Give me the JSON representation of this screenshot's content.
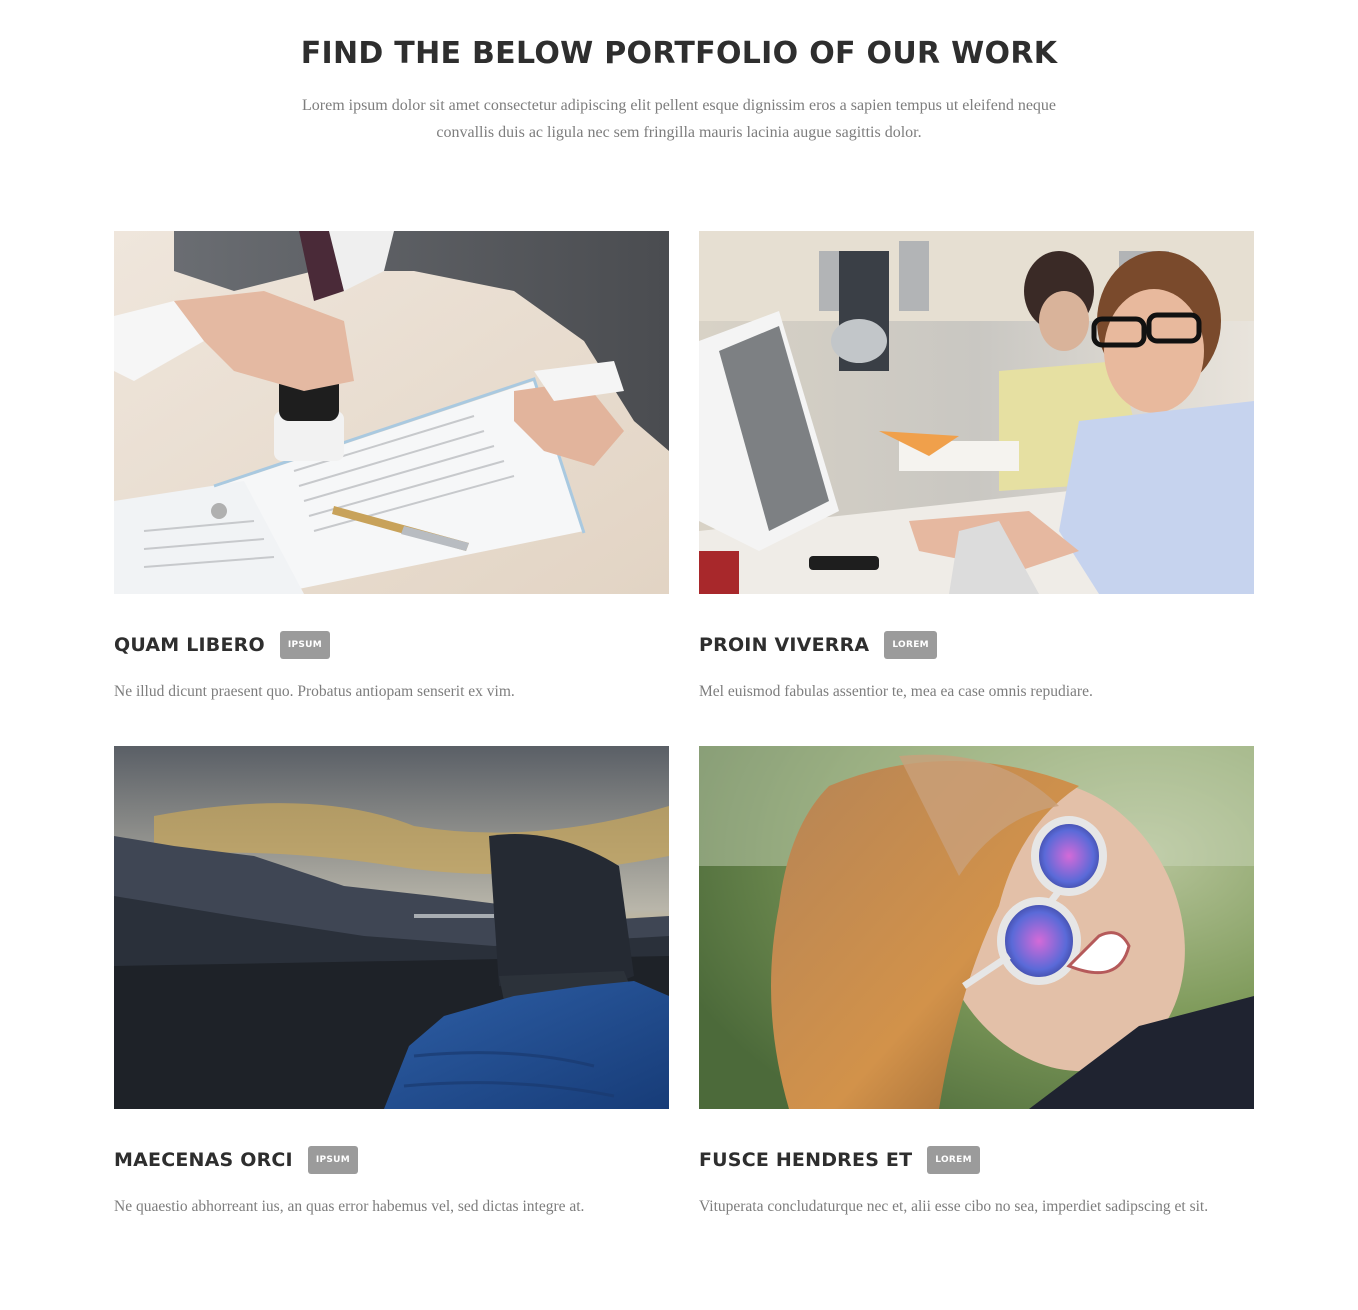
{
  "section": {
    "title": "FIND THE BELOW PORTFOLIO OF OUR WORK",
    "intro": "Lorem ipsum dolor sit amet consectetur adipiscing elit pellent esque dignissim eros a sapien tempus ut eleifend neque convallis duis ac ligula nec sem fringilla mauris lacinia augue sagittis dolor."
  },
  "portfolio": {
    "items": [
      {
        "title": "QUAM LIBERO",
        "badge": "IPSUM",
        "text": "Ne illud dicunt praesent quo. Probatus antiopam senserit ex vim.",
        "image": "businessman-stamping-document-photo"
      },
      {
        "title": "PROIN VIVERRA",
        "badge": "LOREM",
        "text": "Mel euismod fabulas assentior te, mea ea case omnis repudiare.",
        "image": "office-worker-at-computer-photo"
      },
      {
        "title": "MAECENAS ORCI",
        "badge": "IPSUM",
        "text": "Ne quaestio abhorreant ius, an quas error habemus vel, sed dictas integre at.",
        "image": "hiker-mountain-sunset-photo"
      },
      {
        "title": "FUSCE HENDRES ET",
        "badge": "LOREM",
        "text": "Vituperata concludaturque nec et, alii esse cibo no sea, imperdiet sadipscing et sit.",
        "image": "woman-with-sunglasses-photo"
      }
    ]
  },
  "colors": {
    "heading": "#2e2e2e",
    "body_text": "#7d7d7d",
    "badge_bg": "#9b9b9b",
    "badge_text": "#ffffff",
    "background": "#ffffff"
  }
}
